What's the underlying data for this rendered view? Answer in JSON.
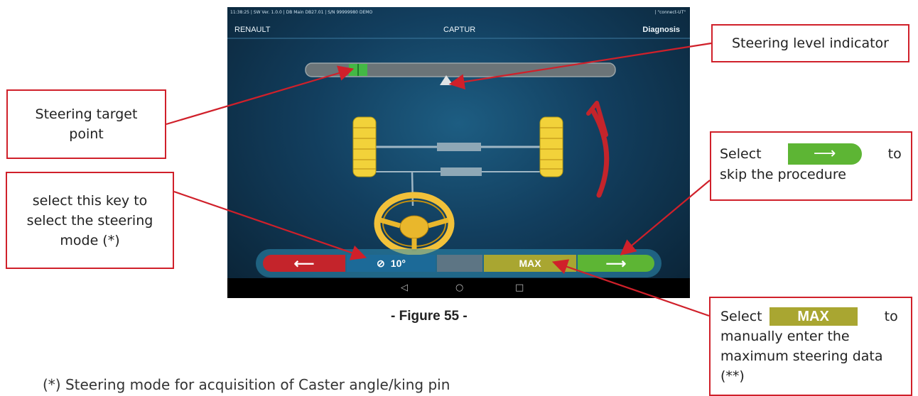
{
  "screen": {
    "status_left": "11:38:25  |  SW Ver. 1.0.0  |  DB Main DB27.01  |  S/N 99999980 DEMO",
    "status_right": "|  \"connect-UT\"",
    "brand": "RENAULT",
    "model": "CAPTUR",
    "section": "Diagnosis",
    "steer_mode_value": "10°",
    "max_label": "MAX",
    "nav_back": "◁",
    "nav_home": "○",
    "nav_recent": "□"
  },
  "callouts": {
    "steering_level": "Steering level indicator",
    "steering_target": "Steering target point",
    "steering_mode": "select this key to select the steering mode (*)",
    "skip_prefix": "Select",
    "skip_suffix": "to",
    "skip_rest": "skip the procedure",
    "max_prefix": "Select",
    "max_button": "MAX",
    "max_suffix": "to",
    "max_rest": "manually enter the maximum steering data (**)"
  },
  "caption": "- Figure 55 -",
  "footnote": "(*) Steering mode for acquisition of Caster angle/king pin",
  "colors": {
    "callout_border": "#d0202a",
    "screen_bg": "#123e5e",
    "btn_red": "#c4242b",
    "btn_blue": "#1c6a98",
    "btn_gray": "#5d7584",
    "btn_olive": "#a9a631",
    "btn_green": "#5db534",
    "wheel_yellow": "#f2d23a"
  }
}
